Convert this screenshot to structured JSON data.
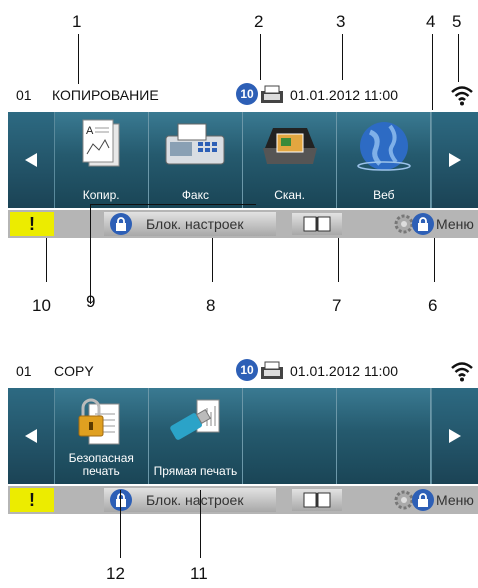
{
  "callouts_top": [
    "1",
    "2",
    "3",
    "4",
    "5"
  ],
  "callouts_bottom": [
    "10",
    "9",
    "8",
    "7",
    "6"
  ],
  "callouts_bottom2": [
    "12",
    "11"
  ],
  "screen1": {
    "status": {
      "number": "01",
      "mode": "КОПИРОВАНИЕ",
      "fax_count": "10",
      "date": "01.01.2012",
      "time": "11:00"
    },
    "tiles": [
      {
        "label": "Копир."
      },
      {
        "label": "Факс"
      },
      {
        "label": "Скан."
      },
      {
        "label": "Веб"
      }
    ],
    "bottom": {
      "warning": "!",
      "lock_label": "Блок. настроек",
      "menu_label": "Меню"
    }
  },
  "screen2": {
    "status": {
      "number": "01",
      "mode": "COPY",
      "fax_count": "10",
      "date": "01.01.2012",
      "time": "11:00"
    },
    "tiles": [
      {
        "label": "Безопасная печать"
      },
      {
        "label": "Прямая печать"
      },
      {
        "label": ""
      },
      {
        "label": ""
      }
    ],
    "bottom": {
      "warning": "!",
      "lock_label": "Блок. настроек",
      "menu_label": "Меню"
    }
  },
  "colors": {
    "tile_bg": "#1f4f63",
    "warning": "#ecec00",
    "badge": "#2d5fb6",
    "bar": "#b5b5b5"
  }
}
